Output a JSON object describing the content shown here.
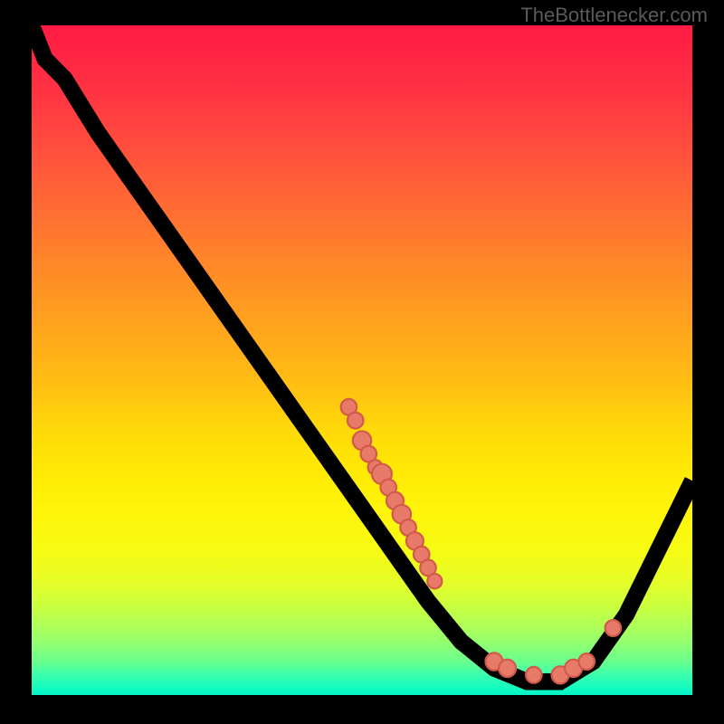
{
  "watermark": "TheBottlenecker.com",
  "chart_data": {
    "type": "line",
    "title": "",
    "xlabel": "",
    "ylabel": "",
    "xlim": [
      0,
      100
    ],
    "ylim": [
      0,
      100
    ],
    "background": "rainbow-vertical-gradient (red top → green bottom)",
    "curve": [
      {
        "x": 0,
        "y": 100
      },
      {
        "x": 2,
        "y": 95
      },
      {
        "x": 5,
        "y": 92
      },
      {
        "x": 10,
        "y": 84
      },
      {
        "x": 15,
        "y": 77
      },
      {
        "x": 20,
        "y": 70
      },
      {
        "x": 25,
        "y": 63
      },
      {
        "x": 30,
        "y": 56
      },
      {
        "x": 35,
        "y": 49
      },
      {
        "x": 40,
        "y": 42
      },
      {
        "x": 45,
        "y": 35
      },
      {
        "x": 50,
        "y": 28
      },
      {
        "x": 55,
        "y": 21
      },
      {
        "x": 60,
        "y": 14
      },
      {
        "x": 65,
        "y": 8
      },
      {
        "x": 70,
        "y": 4
      },
      {
        "x": 75,
        "y": 2
      },
      {
        "x": 80,
        "y": 2
      },
      {
        "x": 85,
        "y": 5
      },
      {
        "x": 90,
        "y": 12
      },
      {
        "x": 95,
        "y": 22
      },
      {
        "x": 100,
        "y": 32
      }
    ],
    "dots": [
      {
        "x": 48,
        "y": 43,
        "r": 1.2
      },
      {
        "x": 49,
        "y": 41,
        "r": 1.2
      },
      {
        "x": 50,
        "y": 38,
        "r": 1.4
      },
      {
        "x": 51,
        "y": 36,
        "r": 1.2
      },
      {
        "x": 52,
        "y": 34,
        "r": 1.1
      },
      {
        "x": 53,
        "y": 33,
        "r": 1.5
      },
      {
        "x": 54,
        "y": 31,
        "r": 1.2
      },
      {
        "x": 55,
        "y": 29,
        "r": 1.3
      },
      {
        "x": 56,
        "y": 27,
        "r": 1.4
      },
      {
        "x": 57,
        "y": 25,
        "r": 1.2
      },
      {
        "x": 58,
        "y": 23,
        "r": 1.3
      },
      {
        "x": 59,
        "y": 21,
        "r": 1.2
      },
      {
        "x": 60,
        "y": 19,
        "r": 1.2
      },
      {
        "x": 61,
        "y": 17,
        "r": 1.1
      },
      {
        "x": 70,
        "y": 5,
        "r": 1.3
      },
      {
        "x": 72,
        "y": 4,
        "r": 1.3
      },
      {
        "x": 76,
        "y": 3,
        "r": 1.2
      },
      {
        "x": 80,
        "y": 3,
        "r": 1.3
      },
      {
        "x": 82,
        "y": 4,
        "r": 1.3
      },
      {
        "x": 84,
        "y": 5,
        "r": 1.2
      },
      {
        "x": 88,
        "y": 10,
        "r": 1.2
      }
    ]
  }
}
